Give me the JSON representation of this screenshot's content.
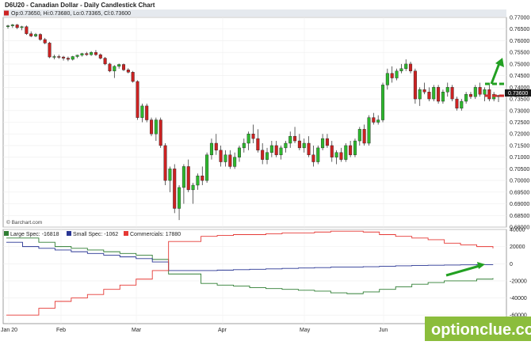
{
  "title": "D6U20 - Canadian Dollar - Daily Candlestick Chart",
  "ohlc_text": "Op:0.73650, Hi:0.73680, Lo:0.73365, Cl:0.73600",
  "credit": "© Barchart.com",
  "watermark": "optionclue.com",
  "last_price_label": "0.73600",
  "colors": {
    "up": "#2db82d",
    "down": "#cc2222",
    "large": "#2e7d32",
    "small": "#283593",
    "commercials": "#e53935",
    "arrow": "#22a022",
    "dashed": "#d32f2f",
    "watermark_bg": "#8bbd3c",
    "panel_border": "#888888"
  },
  "chart_data": [
    {
      "type": "candlestick",
      "title": "D6U20 - Canadian Dollar - Daily Candlestick Chart",
      "ylim": [
        0.68,
        0.77
      ],
      "y_ticks": [
        "0.77000",
        "0.76500",
        "0.76000",
        "0.75500",
        "0.75000",
        "0.74500",
        "0.74000",
        "0.73500",
        "0.73000",
        "0.72500",
        "0.72000",
        "0.71500",
        "0.71000",
        "0.70500",
        "0.70000",
        "0.69500",
        "0.69000",
        "0.68500",
        "0.68000"
      ],
      "x_ticks": [
        "Jan 20",
        "Feb",
        "Mar",
        "Apr",
        "May",
        "Jun"
      ],
      "candles": [
        [
          0.766,
          0.7668,
          0.7652,
          0.7664
        ],
        [
          0.7664,
          0.7672,
          0.7655,
          0.7668
        ],
        [
          0.7668,
          0.7672,
          0.765,
          0.7656
        ],
        [
          0.7656,
          0.7664,
          0.7645,
          0.766
        ],
        [
          0.766,
          0.7665,
          0.7625,
          0.763
        ],
        [
          0.763,
          0.764,
          0.7615,
          0.762
        ],
        [
          0.762,
          0.7633,
          0.7615,
          0.7627
        ],
        [
          0.7627,
          0.7632,
          0.76,
          0.7605
        ],
        [
          0.7605,
          0.7612,
          0.7585,
          0.759
        ],
        [
          0.759,
          0.7595,
          0.7525,
          0.753
        ],
        [
          0.753,
          0.754,
          0.752,
          0.7532
        ],
        [
          0.7532,
          0.754,
          0.7522,
          0.753
        ],
        [
          0.753,
          0.7535,
          0.7515,
          0.7525
        ],
        [
          0.7525,
          0.7532,
          0.7512,
          0.752
        ],
        [
          0.752,
          0.7535,
          0.7515,
          0.7532
        ],
        [
          0.7532,
          0.754,
          0.7525,
          0.7538
        ],
        [
          0.7538,
          0.7548,
          0.7532,
          0.7545
        ],
        [
          0.7545,
          0.7552,
          0.7535,
          0.754
        ],
        [
          0.754,
          0.7555,
          0.7535,
          0.755
        ],
        [
          0.755,
          0.756,
          0.7535,
          0.754
        ],
        [
          0.754,
          0.7545,
          0.752,
          0.7525
        ],
        [
          0.7525,
          0.753,
          0.7495,
          0.75
        ],
        [
          0.75,
          0.7505,
          0.7465,
          0.747
        ],
        [
          0.747,
          0.7495,
          0.744,
          0.749
        ],
        [
          0.749,
          0.7502,
          0.748,
          0.7498
        ],
        [
          0.7498,
          0.7502,
          0.747,
          0.7475
        ],
        [
          0.7475,
          0.7482,
          0.746,
          0.7465
        ],
        [
          0.7465,
          0.747,
          0.742,
          0.7425
        ],
        [
          0.7425,
          0.743,
          0.726,
          0.727
        ],
        [
          0.727,
          0.733,
          0.725,
          0.732
        ],
        [
          0.732,
          0.733,
          0.725,
          0.726
        ],
        [
          0.726,
          0.727,
          0.719,
          0.72
        ],
        [
          0.72,
          0.727,
          0.717,
          0.726
        ],
        [
          0.726,
          0.727,
          0.714,
          0.715
        ],
        [
          0.715,
          0.716,
          0.698,
          0.7
        ],
        [
          0.7,
          0.706,
          0.695,
          0.705
        ],
        [
          0.705,
          0.707,
          0.686,
          0.688
        ],
        [
          0.688,
          0.698,
          0.683,
          0.697
        ],
        [
          0.697,
          0.707,
          0.69,
          0.706
        ],
        [
          0.706,
          0.709,
          0.695,
          0.696
        ],
        [
          0.696,
          0.699,
          0.69,
          0.698
        ],
        [
          0.698,
          0.703,
          0.696,
          0.702
        ],
        [
          0.702,
          0.706,
          0.698,
          0.7
        ],
        [
          0.7,
          0.712,
          0.699,
          0.711
        ],
        [
          0.711,
          0.718,
          0.709,
          0.716
        ],
        [
          0.716,
          0.72,
          0.711,
          0.713
        ],
        [
          0.713,
          0.715,
          0.706,
          0.708
        ],
        [
          0.708,
          0.713,
          0.706,
          0.711
        ],
        [
          0.711,
          0.713,
          0.705,
          0.706
        ],
        [
          0.706,
          0.712,
          0.705,
          0.71
        ],
        [
          0.71,
          0.715,
          0.708,
          0.714
        ],
        [
          0.714,
          0.718,
          0.712,
          0.716
        ],
        [
          0.716,
          0.721,
          0.713,
          0.72
        ],
        [
          0.72,
          0.724,
          0.716,
          0.718
        ],
        [
          0.718,
          0.722,
          0.712,
          0.713
        ],
        [
          0.713,
          0.716,
          0.707,
          0.709
        ],
        [
          0.709,
          0.714,
          0.707,
          0.712
        ],
        [
          0.712,
          0.717,
          0.71,
          0.715
        ],
        [
          0.715,
          0.717,
          0.71,
          0.711
        ],
        [
          0.711,
          0.715,
          0.709,
          0.714
        ],
        [
          0.714,
          0.717,
          0.712,
          0.716
        ],
        [
          0.716,
          0.721,
          0.714,
          0.719
        ],
        [
          0.719,
          0.723,
          0.716,
          0.717
        ],
        [
          0.717,
          0.72,
          0.713,
          0.714
        ],
        [
          0.714,
          0.718,
          0.712,
          0.716
        ],
        [
          0.716,
          0.719,
          0.71,
          0.711
        ],
        [
          0.711,
          0.715,
          0.706,
          0.708
        ],
        [
          0.708,
          0.715,
          0.707,
          0.714
        ],
        [
          0.714,
          0.72,
          0.713,
          0.718
        ],
        [
          0.718,
          0.72,
          0.714,
          0.715
        ],
        [
          0.715,
          0.717,
          0.708,
          0.71
        ],
        [
          0.71,
          0.713,
          0.707,
          0.712
        ],
        [
          0.712,
          0.714,
          0.708,
          0.709
        ],
        [
          0.709,
          0.716,
          0.708,
          0.715
        ],
        [
          0.715,
          0.717,
          0.71,
          0.711
        ],
        [
          0.711,
          0.718,
          0.71,
          0.717
        ],
        [
          0.717,
          0.723,
          0.715,
          0.722
        ],
        [
          0.722,
          0.724,
          0.715,
          0.716
        ],
        [
          0.716,
          0.728,
          0.715,
          0.727
        ],
        [
          0.727,
          0.729,
          0.724,
          0.725
        ],
        [
          0.725,
          0.728,
          0.724,
          0.726
        ],
        [
          0.726,
          0.742,
          0.725,
          0.741
        ],
        [
          0.741,
          0.748,
          0.739,
          0.746
        ],
        [
          0.746,
          0.749,
          0.742,
          0.744
        ],
        [
          0.744,
          0.748,
          0.743,
          0.747
        ],
        [
          0.747,
          0.75,
          0.746,
          0.748
        ],
        [
          0.748,
          0.752,
          0.747,
          0.75
        ],
        [
          0.75,
          0.751,
          0.746,
          0.747
        ],
        [
          0.747,
          0.748,
          0.733,
          0.735
        ],
        [
          0.735,
          0.74,
          0.732,
          0.739
        ],
        [
          0.739,
          0.742,
          0.737,
          0.738
        ],
        [
          0.738,
          0.74,
          0.734,
          0.735
        ],
        [
          0.735,
          0.741,
          0.734,
          0.74
        ],
        [
          0.74,
          0.741,
          0.733,
          0.734
        ],
        [
          0.734,
          0.739,
          0.733,
          0.738
        ],
        [
          0.738,
          0.742,
          0.736,
          0.74
        ],
        [
          0.74,
          0.741,
          0.734,
          0.735
        ],
        [
          0.735,
          0.736,
          0.73,
          0.731
        ],
        [
          0.731,
          0.735,
          0.73,
          0.734
        ],
        [
          0.734,
          0.738,
          0.733,
          0.737
        ],
        [
          0.737,
          0.738,
          0.735,
          0.736
        ],
        [
          0.736,
          0.741,
          0.735,
          0.74
        ],
        [
          0.74,
          0.742,
          0.736,
          0.737
        ],
        [
          0.737,
          0.74,
          0.734,
          0.739
        ],
        [
          0.739,
          0.741,
          0.734,
          0.735
        ],
        [
          0.735,
          0.738,
          0.734,
          0.737
        ],
        [
          0.7365,
          0.7368,
          0.73365,
          0.736
        ]
      ],
      "annotations": [
        "upward arrow",
        "dashed resistance line",
        "dashed support line"
      ]
    },
    {
      "type": "line",
      "ylim": [
        -70000,
        40000
      ],
      "y_ticks": [
        "40000",
        "20000",
        "0",
        "-20000",
        "-40000",
        "-60000"
      ],
      "series": [
        {
          "name": "Large Spec: -16818",
          "values": [
            30000,
            30000,
            25000,
            20000,
            18000,
            16000,
            14000,
            12000,
            10000,
            5000,
            -12000,
            -12000,
            -23000,
            -25000,
            -26000,
            -28000,
            -29000,
            -30000,
            -31000,
            -32000,
            -34000,
            -35000,
            -33000,
            -30000,
            -27000,
            -24000,
            -22000,
            -20000,
            -20000,
            -18000,
            -16818
          ]
        },
        {
          "name": "Small Spec: -1062",
          "values": [
            25000,
            20000,
            18000,
            16000,
            14000,
            12000,
            10000,
            8000,
            6000,
            2000,
            -8000,
            -8000,
            -8000,
            -7500,
            -7000,
            -6500,
            -6000,
            -5500,
            -5000,
            -4500,
            -4000,
            -4000,
            -3500,
            -3000,
            -2500,
            -2000,
            -1800,
            -1500,
            -1300,
            -1100,
            -1062
          ]
        },
        {
          "name": "Commercials: 17880",
          "values": [
            -60000,
            -60000,
            -52000,
            -44000,
            -40000,
            -36000,
            -30000,
            -25000,
            -18000,
            -8000,
            26000,
            26000,
            32000,
            33000,
            34000,
            34000,
            35000,
            36000,
            36000,
            37000,
            38000,
            38000,
            37000,
            34000,
            32000,
            30000,
            28000,
            24000,
            22000,
            20000,
            17880
          ]
        }
      ],
      "annotations": [
        "upward arrow"
      ]
    }
  ]
}
